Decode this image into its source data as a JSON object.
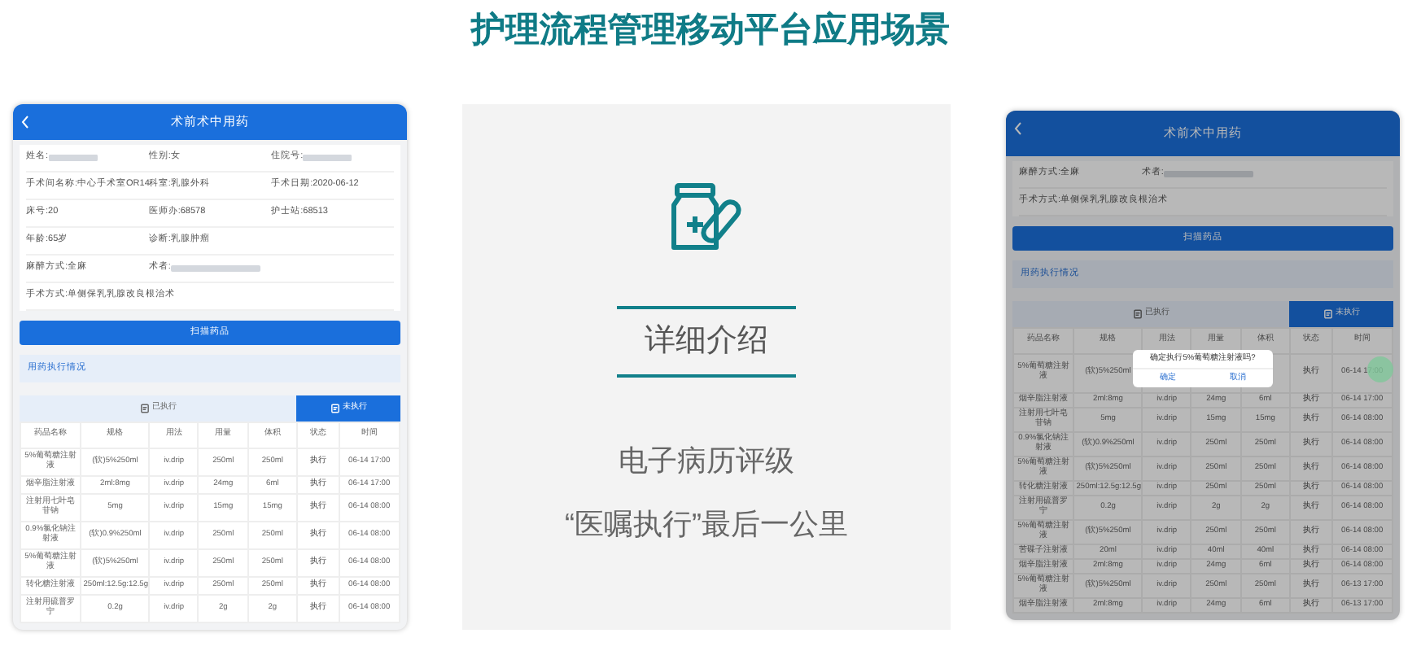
{
  "title": "护理流程管理移动平台应用场景",
  "phones": [
    {
      "title": "术前术中用药",
      "dimmed": false,
      "info_rows": [
        [
          {
            "text": "姓名:",
            "redacted": true
          },
          {
            "text": "性别:女",
            "redacted": false
          },
          {
            "text": "住院号:",
            "redacted": true
          }
        ],
        [
          {
            "text": "手术间名称:中心手术室OR14",
            "redacted": false
          },
          {
            "text": "科室:乳腺外科",
            "redacted": false
          },
          {
            "text": "手术日期:2020-06-12",
            "redacted": false
          }
        ],
        [
          {
            "text": "床号:20",
            "redacted": false
          },
          {
            "text": "医师办:68578",
            "redacted": false
          },
          {
            "text": "护士站:68513",
            "redacted": false
          }
        ],
        [
          {
            "text": "年龄:65岁",
            "redacted": false
          },
          {
            "text": "诊断:乳腺肿瘤",
            "redacted": false
          }
        ],
        [
          {
            "text": "麻醉方式:全麻",
            "redacted": false
          },
          {
            "text": "术者:",
            "redacted": true
          }
        ],
        [
          {
            "text": "手术方式:单侧保乳乳腺改良根治术",
            "redacted": false
          }
        ]
      ],
      "scan_button": "扫描药品",
      "section": "用药执行情况",
      "tabs": [
        {
          "label": "已执行",
          "selected": false
        },
        {
          "label": "未执行",
          "selected": true
        }
      ],
      "columns": [
        "药品名称",
        "规格",
        "用法",
        "用量",
        "体积",
        "状态",
        "时间"
      ],
      "rows": [
        [
          "5%葡萄糖注射液",
          "(软)5%250ml",
          "iv.drip",
          "250ml",
          "250ml",
          "执行",
          "06-14 17:00"
        ],
        [
          "烟辛脂注射液",
          "2ml:8mg",
          "iv.drip",
          "24mg",
          "6ml",
          "执行",
          "06-14 17:00"
        ],
        [
          "注射用七叶皂苷钠",
          "5mg",
          "iv.drip",
          "15mg",
          "15mg",
          "执行",
          "06-14 08:00"
        ],
        [
          "0.9%氯化钠注射液",
          "(软)0.9%250ml",
          "iv.drip",
          "250ml",
          "250ml",
          "执行",
          "06-14 08:00"
        ],
        [
          "5%葡萄糖注射液",
          "(软)5%250ml",
          "iv.drip",
          "250ml",
          "250ml",
          "执行",
          "06-14 08:00"
        ],
        [
          "转化糖注射液",
          "250ml:12.5g:12.5g",
          "iv.drip",
          "250ml",
          "250ml",
          "执行",
          "06-14 08:00"
        ],
        [
          "注射用硫普罗宁",
          "0.2g",
          "iv.drip",
          "2g",
          "2g",
          "执行",
          "06-14 08:00"
        ]
      ]
    },
    {
      "title": "术前术中用药",
      "dimmed": true,
      "info_rows": [
        [
          {
            "text": "麻醉方式:全麻",
            "redacted": false
          },
          {
            "text": "术者:",
            "redacted": true
          }
        ],
        [
          {
            "text": "手术方式:单侧保乳乳腺改良根治术",
            "redacted": false
          }
        ]
      ],
      "scan_button": "扫描药品",
      "section": "用药执行情况",
      "tabs": [
        {
          "label": "已执行",
          "selected": false
        },
        {
          "label": "未执行",
          "selected": true
        }
      ],
      "columns": [
        "药品名称",
        "规格",
        "用法",
        "用量",
        "体积",
        "状态",
        "时间"
      ],
      "rows": [
        [
          "5%葡萄糖注射液",
          "(软)5%250ml",
          null,
          null,
          null,
          "执行",
          "06-14 17:00"
        ],
        [
          "烟辛脂注射液",
          "2ml:8mg",
          "iv.drip",
          "24mg",
          "6ml",
          "执行",
          "06-14 17:00"
        ],
        [
          "注射用七叶皂苷钠",
          "5mg",
          "iv.drip",
          "15mg",
          "15mg",
          "执行",
          "06-14 08:00"
        ],
        [
          "0.9%氯化钠注射液",
          "(软)0.9%250ml",
          "iv.drip",
          "250ml",
          "250ml",
          "执行",
          "06-14 08:00"
        ],
        [
          "5%葡萄糖注射液",
          "(软)5%250ml",
          "iv.drip",
          "250ml",
          "250ml",
          "执行",
          "06-14 08:00"
        ],
        [
          "转化糖注射液",
          "250ml:12.5g:12.5g",
          "iv.drip",
          "250ml",
          "250ml",
          "执行",
          "06-14 08:00"
        ],
        [
          "注射用硫普罗宁",
          "0.2g",
          "iv.drip",
          "2g",
          "2g",
          "执行",
          "06-14 08:00"
        ],
        [
          "5%葡萄糖注射液",
          "(软)5%250ml",
          "iv.drip",
          "250ml",
          "250ml",
          "执行",
          "06-14 08:00"
        ],
        [
          "苦碟子注射液",
          "20ml",
          "iv.drip",
          "40ml",
          "40ml",
          "执行",
          "06-14 08:00"
        ],
        [
          "烟辛脂注射液",
          "2ml:8mg",
          "iv.drip",
          "24mg",
          "6ml",
          "执行",
          "06-14 08:00"
        ],
        [
          "5%葡萄糖注射液",
          "(软)5%250ml",
          "iv.drip",
          "250ml",
          "250ml",
          "执行",
          "06-13 17:00"
        ],
        [
          "烟辛脂注射液",
          "2ml:8mg",
          "iv.drip",
          "24mg",
          "6ml",
          "执行",
          "06-13 17:00"
        ]
      ],
      "dialog": {
        "message": "确定执行5%葡萄糖注射液吗?",
        "buttons": [
          "确定",
          "取消"
        ]
      }
    }
  ],
  "detail": {
    "heading": "详细介绍",
    "lines": [
      "电子病历评级",
      "“医嘱执行”最后一公里"
    ]
  }
}
